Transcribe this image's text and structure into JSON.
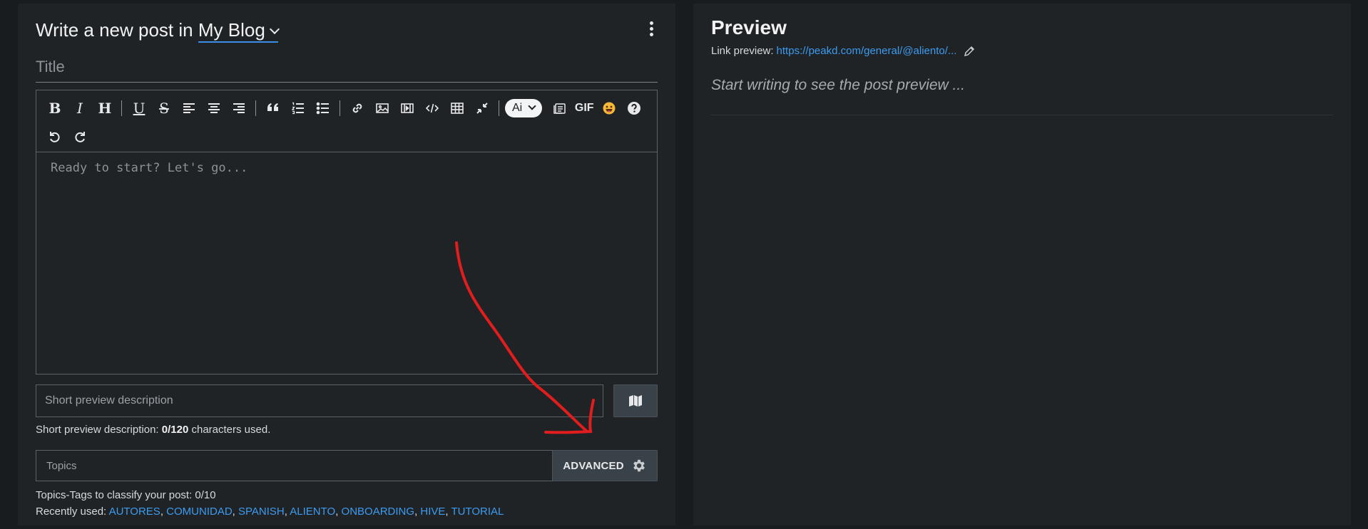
{
  "editor": {
    "header_prefix": "Write a new post in",
    "community": "My Blog",
    "title_placeholder": "Title",
    "body_placeholder": "Ready to start? Let's go...",
    "toolbar": {
      "bold": "B",
      "italic": "I",
      "heading": "H",
      "underline": "U",
      "strike": "S",
      "ai_label": "Ai",
      "gif_label": "GIF"
    },
    "description_placeholder": "Short preview description",
    "description_hint_prefix": "Short preview description:",
    "description_count": "0/120",
    "description_hint_suffix": "characters used.",
    "topics_placeholder": "Topics",
    "advanced_label": "ADVANCED",
    "topics_hint": "Topics-Tags to classify your post: 0/10",
    "recent_label": "Recently used:",
    "recent_tags": [
      "AUTORES",
      "COMUNIDAD",
      "SPANISH",
      "ALIENTO",
      "ONBOARDING",
      "HIVE",
      "TUTORIAL"
    ]
  },
  "preview": {
    "title": "Preview",
    "link_label": "Link preview:",
    "link_url": "https://peakd.com/general/@aliento/...",
    "placeholder": "Start writing to see the post preview ..."
  },
  "colors": {
    "background": "#191c1f",
    "panel": "#1f2326",
    "accent_link": "#3d9bf0",
    "annotation": "#e21d1d"
  }
}
